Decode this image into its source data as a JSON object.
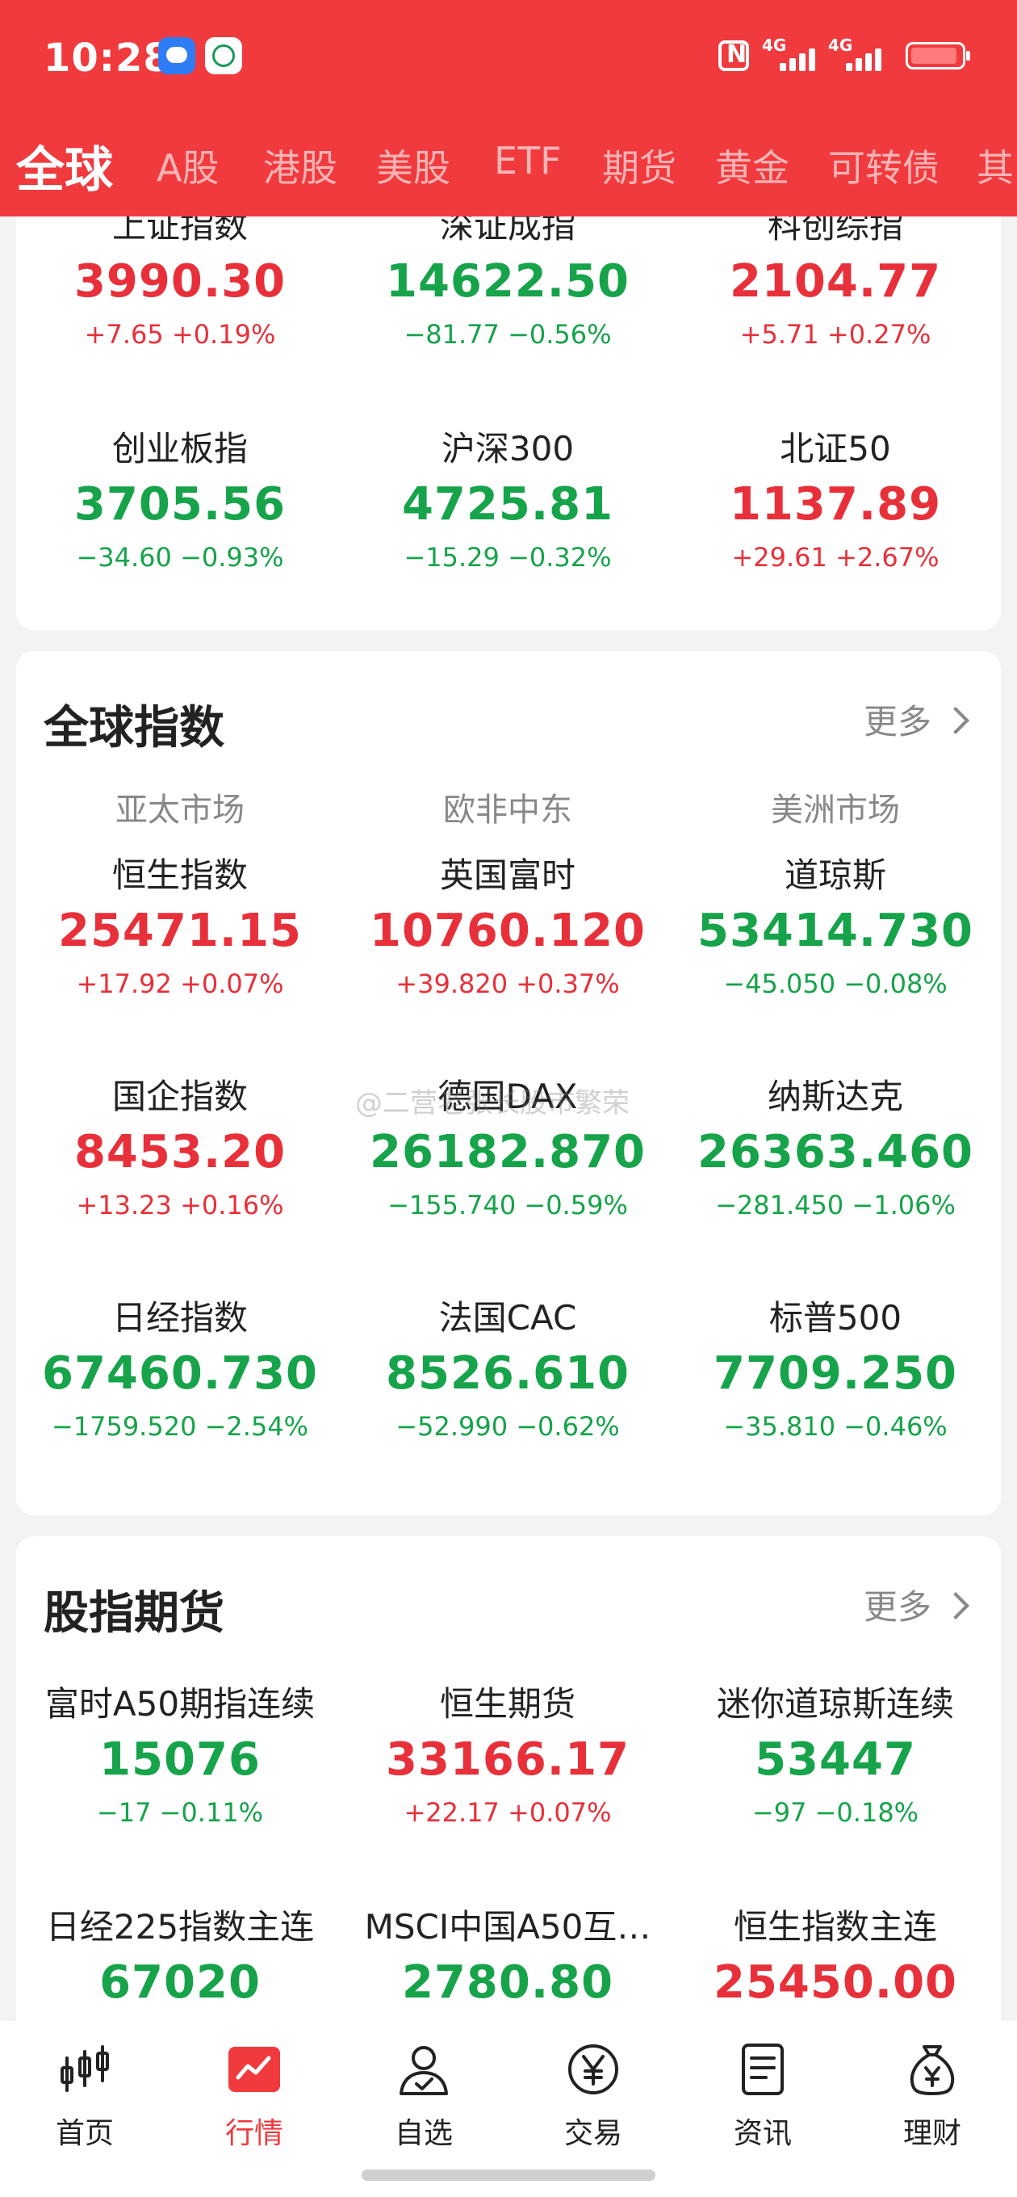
{
  "status_bar": {
    "time": "10:28",
    "net1": "4G",
    "net2": "4G"
  },
  "tabs": [
    "全球",
    "A股",
    "港股",
    "美股",
    "ETF",
    "期货",
    "黄金",
    "可转债",
    "其"
  ],
  "domestic": [
    {
      "name": "上证指数",
      "price": "3990.30",
      "change": "+7.65  +0.19%",
      "dir": "up"
    },
    {
      "name": "深证成指",
      "price": "14622.50",
      "change": "−81.77  −0.56%",
      "dir": "dn"
    },
    {
      "name": "科创综指",
      "price": "2104.77",
      "change": "+5.71  +0.27%",
      "dir": "up"
    },
    {
      "name": "创业板指",
      "price": "3705.56",
      "change": "−34.60  −0.93%",
      "dir": "dn"
    },
    {
      "name": "沪深300",
      "price": "4725.81",
      "change": "−15.29  −0.32%",
      "dir": "dn"
    },
    {
      "name": "北证50",
      "price": "1137.89",
      "change": "+29.61  +2.67%",
      "dir": "up"
    }
  ],
  "global": {
    "title": "全球指数",
    "more": "更多",
    "regions": [
      "亚太市场",
      "欧非中东",
      "美洲市场"
    ],
    "items": [
      {
        "name": "恒生指数",
        "price": "25471.15",
        "change": "+17.92  +0.07%",
        "dir": "up"
      },
      {
        "name": "英国富时",
        "price": "10760.120",
        "change": "+39.820  +0.37%",
        "dir": "up"
      },
      {
        "name": "道琼斯",
        "price": "53414.730",
        "change": "−45.050  −0.08%",
        "dir": "dn"
      },
      {
        "name": "国企指数",
        "price": "8453.20",
        "change": "+13.23  +0.16%",
        "dir": "up"
      },
      {
        "name": "德国DAX",
        "price": "26182.870",
        "change": "−155.740  −0.59%",
        "dir": "dn"
      },
      {
        "name": "纳斯达克",
        "price": "26363.460",
        "change": "−281.450  −1.06%",
        "dir": "dn"
      },
      {
        "name": "日经指数",
        "price": "67460.730",
        "change": "−1759.520  −2.54%",
        "dir": "dn"
      },
      {
        "name": "法国CAC",
        "price": "8526.610",
        "change": "−52.990  −0.62%",
        "dir": "dn"
      },
      {
        "name": "标普500",
        "price": "7709.250",
        "change": "−35.810  −0.46%",
        "dir": "dn"
      }
    ]
  },
  "futures": {
    "title": "股指期货",
    "more": "更多",
    "items": [
      {
        "name": "富时A50期指连续",
        "price": "15076",
        "change": "−17  −0.11%",
        "dir": "dn"
      },
      {
        "name": "恒生期货",
        "price": "33166.17",
        "change": "+22.17  +0.07%",
        "dir": "up"
      },
      {
        "name": "迷你道琼斯连续",
        "price": "53447",
        "change": "−97  −0.18%",
        "dir": "dn"
      },
      {
        "name": "日经225指数主连",
        "price": "67020",
        "change": "",
        "dir": "dn"
      },
      {
        "name": "MSCI中国A50互…",
        "price": "2780.80",
        "change": "",
        "dir": "dn"
      },
      {
        "name": "恒生指数主连",
        "price": "25450.00",
        "change": "",
        "dir": "up"
      }
    ]
  },
  "watermark": "@二营老张长股市繁荣",
  "bottom_nav": [
    "首页",
    "行情",
    "自选",
    "交易",
    "资讯",
    "理财"
  ]
}
